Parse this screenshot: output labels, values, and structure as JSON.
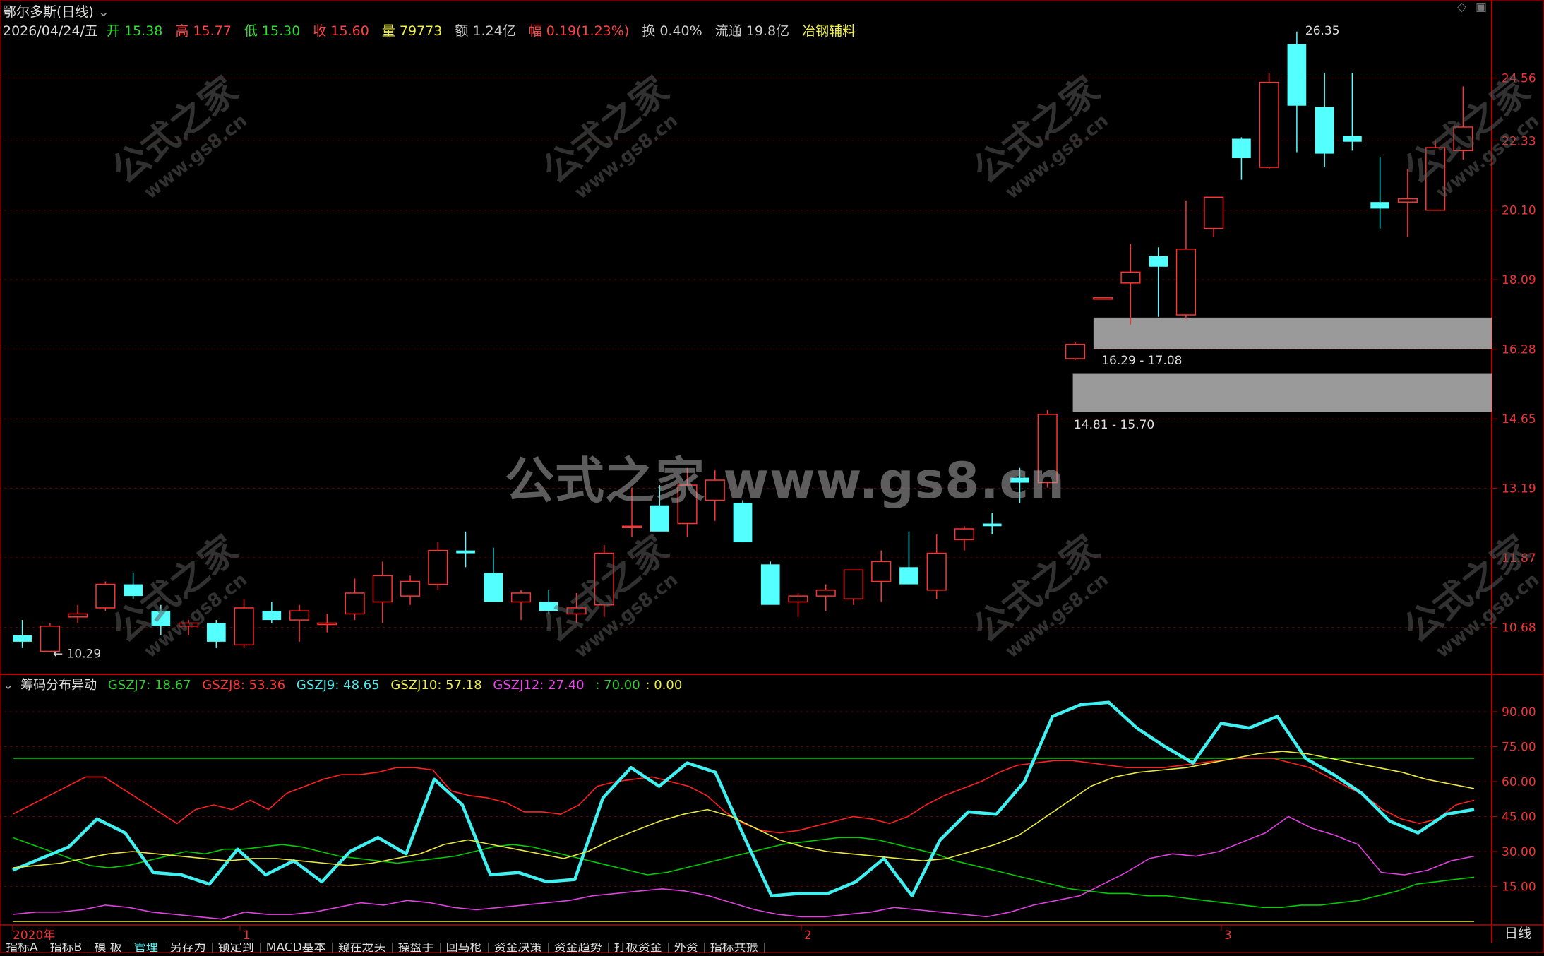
{
  "header": {
    "title": "鄂尔多斯(日线)",
    "date": "2026/04/24/五",
    "open_label": "开",
    "open": "15.38",
    "high_label": "高",
    "high": "15.77",
    "low_label": "低",
    "low": "15.30",
    "close_label": "收",
    "close": "15.60",
    "volume_label": "量",
    "volume": "79773",
    "amount_label": "额",
    "amount": "1.24亿",
    "change_label": "幅",
    "change": "0.19(1.23%)",
    "turnover_label": "换",
    "turnover": "0.40%",
    "float_label": "流通",
    "float": "19.8亿",
    "sector": "冶钢辅料"
  },
  "colors": {
    "up": "#ff3333",
    "down": "#54ffff",
    "grid": "#6a0000",
    "green": "#00cc00",
    "red": "#ff2020",
    "cyan": "#40f0f0",
    "yellow": "#e8e840",
    "magenta": "#e040e0"
  },
  "watermark": {
    "main": "公式之家 www.gs8.cn",
    "small_title": "公式之家",
    "small_url": "www.gs8.cn"
  },
  "indicator": {
    "name": "筹码分布异动",
    "gszj7": "GSZJ7: 18.67",
    "gszj8": "GSZJ8: 53.36",
    "gszj9": "GSZJ9: 48.65",
    "gszj10": "GSZJ10: 57.18",
    "gszj12": "GSZJ12: 27.40",
    "v70": ": 70.00",
    "v0": ": 0.00"
  },
  "price_axis": [
    "24.56",
    "22.33",
    "20.10",
    "18.09",
    "16.28",
    "14.65",
    "13.19",
    "11.87",
    "10.68"
  ],
  "ind_axis": [
    "90.00",
    "75.00",
    "60.00",
    "45.00",
    "30.00",
    "15.00"
  ],
  "time_axis": [
    "2020年",
    "1",
    "2",
    "3"
  ],
  "period": "日线",
  "bottom_tabs": [
    "指标A",
    "指标B",
    "模 板",
    "管理",
    "另存为",
    "锁定到",
    "MACD基本",
    "窥在龙头",
    "操盘手",
    "回马枪",
    "资金决策",
    "资金趋势",
    "打板资金",
    "外资",
    "指标共振"
  ],
  "chart_data": [
    {
      "type": "candlestick",
      "title": "鄂尔多斯(日线)",
      "ylim": [
        10.0,
        27.0
      ],
      "annotations": {
        "high": "26.35",
        "low": "10.29",
        "gap1": "16.29 - 17.08",
        "gap2": "14.81 - 15.70"
      },
      "gaps": [
        [
          16.29,
          17.08
        ],
        [
          14.81,
          15.7
        ]
      ],
      "ohlc": [
        [
          10.55,
          10.8,
          10.35,
          10.45
        ],
        [
          10.3,
          10.75,
          10.29,
          10.7
        ],
        [
          10.85,
          11.05,
          10.75,
          10.9
        ],
        [
          11.0,
          11.45,
          10.95,
          11.4
        ],
        [
          11.4,
          11.6,
          11.15,
          11.2
        ],
        [
          10.95,
          11.05,
          10.55,
          10.7
        ],
        [
          10.7,
          10.8,
          10.55,
          10.75
        ],
        [
          10.75,
          10.8,
          10.35,
          10.45
        ],
        [
          10.4,
          11.15,
          10.35,
          11.0
        ],
        [
          10.95,
          11.1,
          10.75,
          10.8
        ],
        [
          10.8,
          11.05,
          10.45,
          10.95
        ],
        [
          10.75,
          10.9,
          10.6,
          10.75
        ],
        [
          10.9,
          11.5,
          10.8,
          11.25
        ],
        [
          11.1,
          11.8,
          10.75,
          11.55
        ],
        [
          11.2,
          11.55,
          11.05,
          11.45
        ],
        [
          11.4,
          12.15,
          11.3,
          12.0
        ],
        [
          12.0,
          12.35,
          11.7,
          11.95
        ],
        [
          11.6,
          12.05,
          11.15,
          11.1
        ],
        [
          11.1,
          11.3,
          10.8,
          11.25
        ],
        [
          11.1,
          11.3,
          10.9,
          10.95
        ],
        [
          10.9,
          11.25,
          10.75,
          11.0
        ],
        [
          11.05,
          12.1,
          10.85,
          11.95
        ],
        [
          12.45,
          13.2,
          12.25,
          12.45
        ],
        [
          12.85,
          13.25,
          12.45,
          12.35
        ],
        [
          12.5,
          13.6,
          12.25,
          13.25
        ],
        [
          12.95,
          13.55,
          12.55,
          13.35
        ],
        [
          12.9,
          12.95,
          12.15,
          12.15
        ],
        [
          11.75,
          11.8,
          11.1,
          11.05
        ],
        [
          11.1,
          11.25,
          10.85,
          11.2
        ],
        [
          11.2,
          11.4,
          10.95,
          11.3
        ],
        [
          11.15,
          11.65,
          11.05,
          11.65
        ],
        [
          11.45,
          12.0,
          11.1,
          11.8
        ],
        [
          11.7,
          12.35,
          11.4,
          11.4
        ],
        [
          11.3,
          12.3,
          11.15,
          11.95
        ],
        [
          12.2,
          12.45,
          12.0,
          12.4
        ],
        [
          12.5,
          12.7,
          12.3,
          12.45
        ],
        [
          13.4,
          13.6,
          12.9,
          13.3
        ],
        [
          13.3,
          14.85,
          13.2,
          14.75
        ],
        [
          16.05,
          16.45,
          16.02,
          16.4
        ],
        [
          17.6,
          17.6,
          17.6,
          17.6
        ],
        [
          18.0,
          19.1,
          16.9,
          18.3
        ],
        [
          18.75,
          19.0,
          17.1,
          18.45
        ],
        [
          17.15,
          20.4,
          17.05,
          18.95
        ],
        [
          19.55,
          20.4,
          19.3,
          20.5
        ],
        [
          22.4,
          22.45,
          21.05,
          21.75
        ],
        [
          21.45,
          24.75,
          21.4,
          24.4
        ],
        [
          25.85,
          26.35,
          21.95,
          23.55
        ],
        [
          23.5,
          24.75,
          21.45,
          21.9
        ],
        [
          22.5,
          24.75,
          22.0,
          22.3
        ],
        [
          20.35,
          21.8,
          19.55,
          20.15
        ],
        [
          20.35,
          21.4,
          19.3,
          20.45
        ],
        [
          20.1,
          22.35,
          20.1,
          22.1
        ],
        [
          22.0,
          24.25,
          21.7,
          22.8
        ]
      ]
    },
    {
      "type": "line",
      "title": "筹码分布异动",
      "ylim": [
        0,
        100
      ],
      "ref_lines": [
        70,
        0
      ],
      "series": [
        {
          "name": "GSZJ7",
          "color": "#00cc00",
          "values": [
            36,
            33,
            30,
            27,
            24,
            23,
            24,
            26,
            28,
            30,
            29,
            31,
            31,
            32,
            33,
            32,
            30,
            28,
            27,
            26,
            25,
            26,
            27,
            28,
            30,
            32,
            33,
            32,
            30,
            28,
            26,
            24,
            22,
            20,
            21,
            23,
            25,
            27,
            29,
            31,
            33,
            34,
            35,
            36,
            36,
            35,
            33,
            31,
            29,
            26,
            24,
            22,
            20,
            18,
            16,
            14,
            13,
            12,
            12,
            11,
            11,
            10,
            9,
            8,
            7,
            6,
            6,
            7,
            7,
            8,
            9,
            11,
            13,
            16,
            17,
            18,
            19
          ]
        },
        {
          "name": "GSZJ8",
          "color": "#ff2020",
          "values": [
            46,
            50,
            54,
            58,
            62,
            62,
            57,
            52,
            47,
            42,
            48,
            50,
            48,
            52,
            48,
            55,
            58,
            61,
            63,
            63,
            64,
            66,
            66,
            65,
            56,
            54,
            53,
            51,
            47,
            47,
            46,
            50,
            58,
            60,
            61,
            62,
            60,
            58,
            54,
            47,
            42,
            39,
            38,
            39,
            41,
            43,
            45,
            44,
            42,
            45,
            50,
            54,
            57,
            60,
            64,
            67,
            68,
            69,
            69,
            68,
            67,
            66,
            66,
            66,
            67,
            68,
            69,
            70,
            70,
            70,
            68,
            66,
            62,
            58,
            54,
            48,
            44,
            42,
            44,
            50,
            52
          ]
        },
        {
          "name": "GSZJ9",
          "color": "#40f0f0",
          "values": [
            22,
            27,
            32,
            44,
            38,
            21,
            20,
            16,
            31,
            20,
            26,
            17,
            30,
            36,
            29,
            61,
            50,
            20,
            21,
            17,
            18,
            53,
            66,
            58,
            68,
            64,
            37,
            11,
            12,
            12,
            17,
            27,
            11,
            35,
            47,
            46,
            60,
            88,
            93,
            94,
            83,
            75,
            68,
            85,
            83,
            88,
            70,
            63,
            55,
            43,
            38,
            46,
            48
          ]
        },
        {
          "name": "GSZJ10",
          "color": "#e8e840",
          "values": [
            23,
            24,
            25,
            27,
            29,
            30,
            29,
            28,
            27,
            26,
            27,
            27,
            26,
            25,
            24,
            25,
            27,
            29,
            33,
            35,
            33,
            31,
            29,
            27,
            30,
            35,
            39,
            43,
            46,
            48,
            45,
            40,
            35,
            32,
            30,
            29,
            28,
            27,
            26,
            27,
            30,
            33,
            37,
            44,
            51,
            58,
            62,
            64,
            65,
            66,
            68,
            70,
            72,
            73,
            72,
            70,
            68,
            66,
            64,
            61,
            59,
            57
          ]
        },
        {
          "name": "GSZJ12",
          "color": "#e040e0",
          "values": [
            3,
            4,
            4,
            5,
            7,
            6,
            4,
            3,
            2,
            1,
            4,
            3,
            3,
            4,
            6,
            8,
            7,
            9,
            8,
            6,
            5,
            6,
            7,
            8,
            9,
            11,
            12,
            13,
            14,
            13,
            11,
            8,
            5,
            3,
            2,
            2,
            3,
            4,
            6,
            5,
            4,
            3,
            2,
            4,
            7,
            9,
            11,
            16,
            21,
            27,
            29,
            28,
            30,
            34,
            38,
            45,
            40,
            37,
            33,
            21,
            20,
            22,
            26,
            28
          ]
        }
      ]
    }
  ]
}
